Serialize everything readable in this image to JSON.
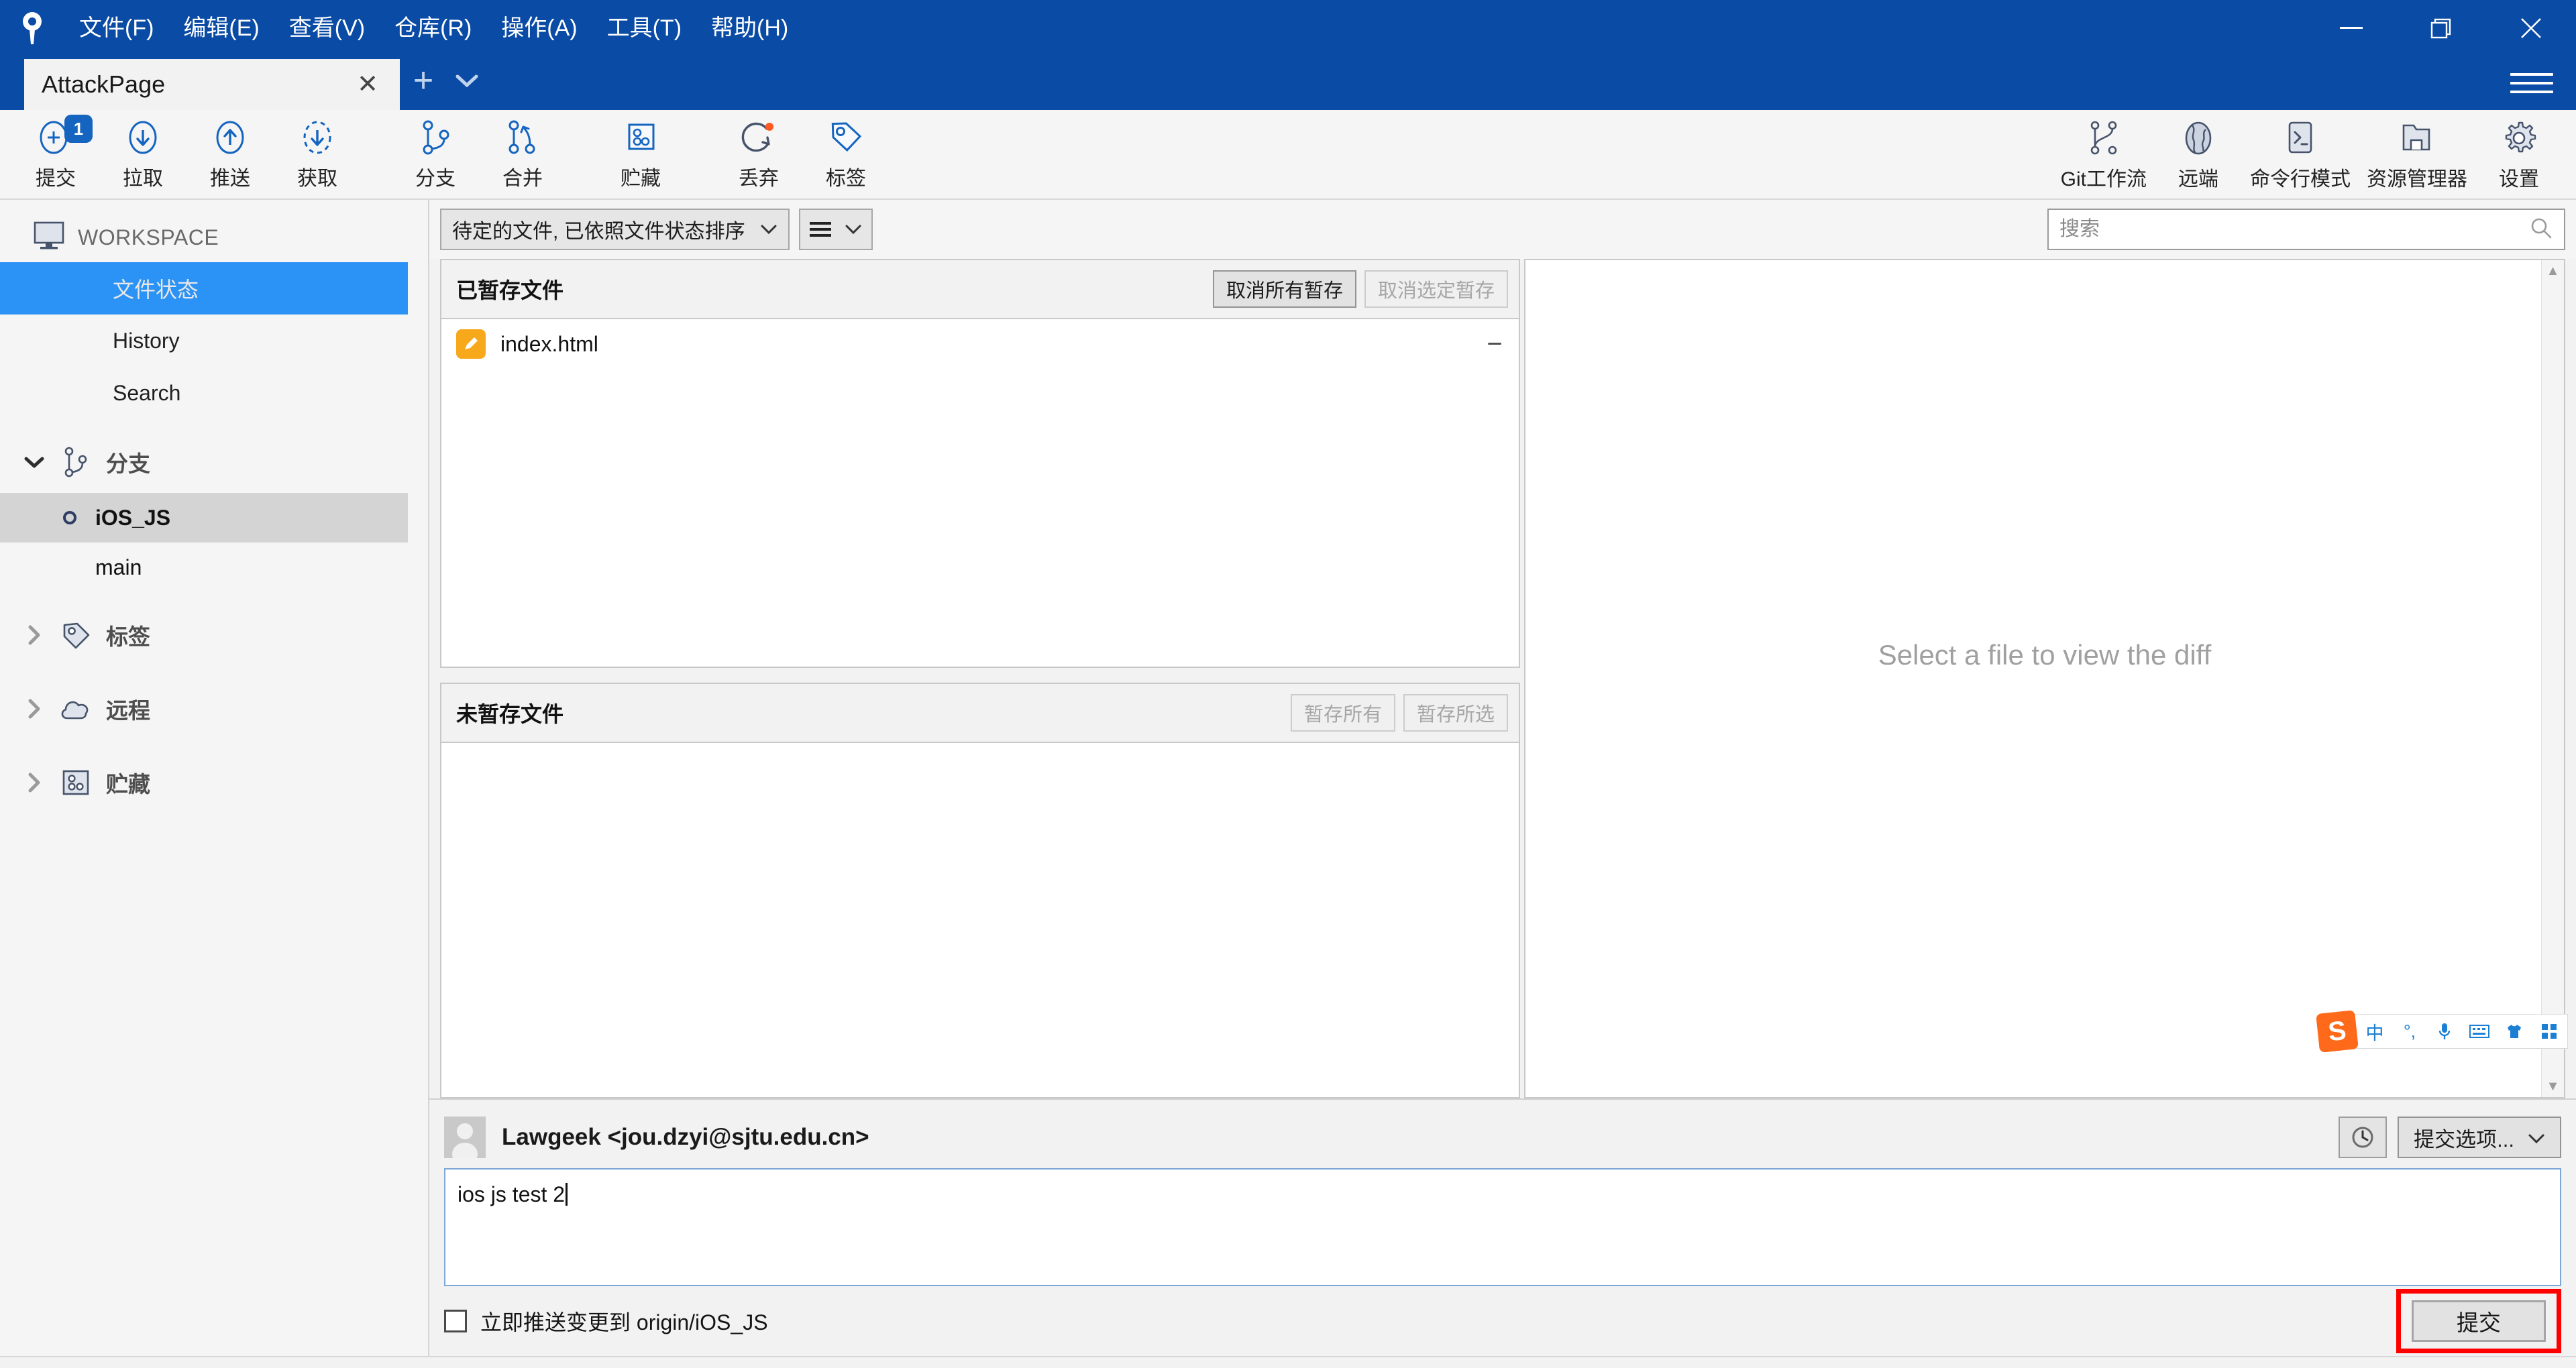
{
  "window": {
    "app_icon": "sourcetree-logo-icon",
    "minimize_label": "—",
    "maximize_label": "□",
    "close_label": "✕"
  },
  "menubar": {
    "items": [
      {
        "label": "文件(F)",
        "name": "menu-file"
      },
      {
        "label": "编辑(E)",
        "name": "menu-edit"
      },
      {
        "label": "查看(V)",
        "name": "menu-view"
      },
      {
        "label": "仓库(R)",
        "name": "menu-repository"
      },
      {
        "label": "操作(A)",
        "name": "menu-actions"
      },
      {
        "label": "工具(T)",
        "name": "menu-tools"
      },
      {
        "label": "帮助(H)",
        "name": "menu-help"
      }
    ]
  },
  "tabs": {
    "active": "AttackPage",
    "close_label": "✕",
    "new_tab_label": "+",
    "dropdown_label": "▾"
  },
  "toolbar": {
    "left": [
      {
        "label": "提交",
        "icon": "commit-plus-circle-icon",
        "badge": "1"
      },
      {
        "label": "拉取",
        "icon": "pull-down-arrow-circle-icon",
        "badge": ""
      },
      {
        "label": "推送",
        "icon": "push-up-arrow-circle-icon",
        "badge": ""
      },
      {
        "label": "获取",
        "icon": "fetch-dashed-circle-icon",
        "badge": ""
      },
      {
        "label": "分支",
        "icon": "branch-icon",
        "badge": ""
      },
      {
        "label": "合并",
        "icon": "merge-icon",
        "badge": ""
      },
      {
        "label": "贮藏",
        "icon": "stash-box-icon",
        "badge": ""
      },
      {
        "label": "丢弃",
        "icon": "discard-reset-icon",
        "badge": ""
      },
      {
        "label": "标签",
        "icon": "tag-icon",
        "badge": ""
      }
    ],
    "right": [
      {
        "label": "Git工作流",
        "icon": "gitflow-icon"
      },
      {
        "label": "远端",
        "icon": "globe-remote-icon"
      },
      {
        "label": "命令行模式",
        "icon": "terminal-icon"
      },
      {
        "label": "资源管理器",
        "icon": "folder-explorer-icon"
      },
      {
        "label": "设置",
        "icon": "gear-settings-icon"
      }
    ]
  },
  "sidebar": {
    "workspace_title": "WORKSPACE",
    "workspace_icon": "monitor-icon",
    "items": [
      {
        "label": "文件状态",
        "selected": true
      },
      {
        "label": "History",
        "selected": false
      },
      {
        "label": "Search",
        "selected": false
      }
    ],
    "groups": [
      {
        "label": "分支",
        "icon": "branch-icon",
        "expanded": true,
        "arrow": "▾",
        "branches": [
          {
            "label": "iOS_JS",
            "current": true
          },
          {
            "label": "main",
            "current": false
          }
        ]
      },
      {
        "label": "标签",
        "icon": "tag-icon",
        "expanded": false,
        "arrow": "›",
        "branches": []
      },
      {
        "label": "远程",
        "icon": "cloud-icon",
        "expanded": false,
        "arrow": "›",
        "branches": []
      },
      {
        "label": "贮藏",
        "icon": "stash-box-icon",
        "expanded": false,
        "arrow": "›",
        "branches": []
      }
    ]
  },
  "filterbar": {
    "file_filter": "待定的文件, 已依照文件状态排序",
    "file_filter_caret": "⌄",
    "view_mode_icon": "list-view-icon",
    "view_mode_caret": "⌄",
    "search_placeholder": "搜索",
    "search_value": "",
    "search_icon": "magnifier-icon"
  },
  "staged": {
    "title": "已暂存文件",
    "unstage_all_label": "取消所有暂存",
    "unstage_all_disabled": false,
    "unstage_selected_label": "取消选定暂存",
    "unstage_selected_disabled": true,
    "files": [
      {
        "name": "index.html",
        "status_icon": "modified-pencil-icon",
        "action": "−"
      }
    ]
  },
  "unstaged": {
    "title": "未暂存文件",
    "stage_all_label": "暂存所有",
    "stage_all_disabled": true,
    "stage_selected_label": "暂存所选",
    "stage_selected_disabled": true,
    "files": []
  },
  "diff": {
    "placeholder": "Select a file to view the diff",
    "scroll_up": "▲",
    "scroll_down": "▼"
  },
  "commit": {
    "author": "Lawgeek <jou.dzyi@sjtu.edu.cn>",
    "avatar_icon": "user-avatar-icon",
    "history_button_icon": "clock-history-icon",
    "options_label": "提交选项...",
    "options_caret": "⌄",
    "message": "ios js test 2",
    "push_checkbox_label": "立即推送变更到 origin/iOS_JS",
    "push_checked": false,
    "commit_button_label": "提交",
    "highlight_color": "#ff0000"
  },
  "ime": {
    "logo_label": "S",
    "items": [
      "中",
      "°,",
      "mic-icon",
      "keyboard-icon",
      "shirt-icon",
      "apps-icon"
    ]
  },
  "colors": {
    "titlebar": "#0a4ba5",
    "accent_blue": "#2b92f6",
    "toolbar_icon_blue": "#1565c0",
    "modified_orange": "#f7a91b",
    "chrome": "#f5f5f5"
  }
}
